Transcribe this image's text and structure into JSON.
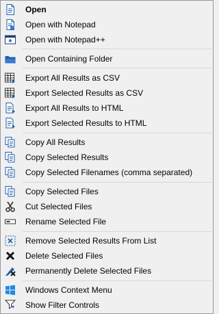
{
  "menu": {
    "items": [
      {
        "label": "Open",
        "icon": "document-icon"
      },
      {
        "label": "Open with Notepad",
        "icon": "notepad-icon"
      },
      {
        "label": "Open with Notepad++",
        "icon": "notepadpp-icon"
      },
      {
        "label": "Open Containing Folder",
        "icon": "folder-icon"
      },
      {
        "label": "Export All Results as CSV",
        "icon": "grid-export-icon"
      },
      {
        "label": "Export Selected Results as CSV",
        "icon": "grid-export-icon"
      },
      {
        "label": "Export All Results to HTML",
        "icon": "html-export-icon"
      },
      {
        "label": "Export Selected Results to HTML",
        "icon": "html-export-icon"
      },
      {
        "label": "Copy All Results",
        "icon": "copy-icon"
      },
      {
        "label": "Copy Selected Results",
        "icon": "copy-icon"
      },
      {
        "label": "Copy Selected Filenames (comma separated)",
        "icon": "copy-icon"
      },
      {
        "label": "Copy Selected Files",
        "icon": "copy-icon"
      },
      {
        "label": "Cut Selected Files",
        "icon": "scissors-icon"
      },
      {
        "label": "Rename Selected File",
        "icon": "rename-icon"
      },
      {
        "label": "Remove Selected Results From List",
        "icon": "remove-from-list-icon"
      },
      {
        "label": "Delete Selected Files",
        "icon": "delete-x-icon"
      },
      {
        "label": "Permanently Delete Selected Files",
        "icon": "permanent-delete-icon"
      },
      {
        "label": "Windows Context Menu",
        "icon": "windows-icon"
      },
      {
        "label": "Show Filter Controls",
        "icon": "filter-icon"
      }
    ]
  }
}
